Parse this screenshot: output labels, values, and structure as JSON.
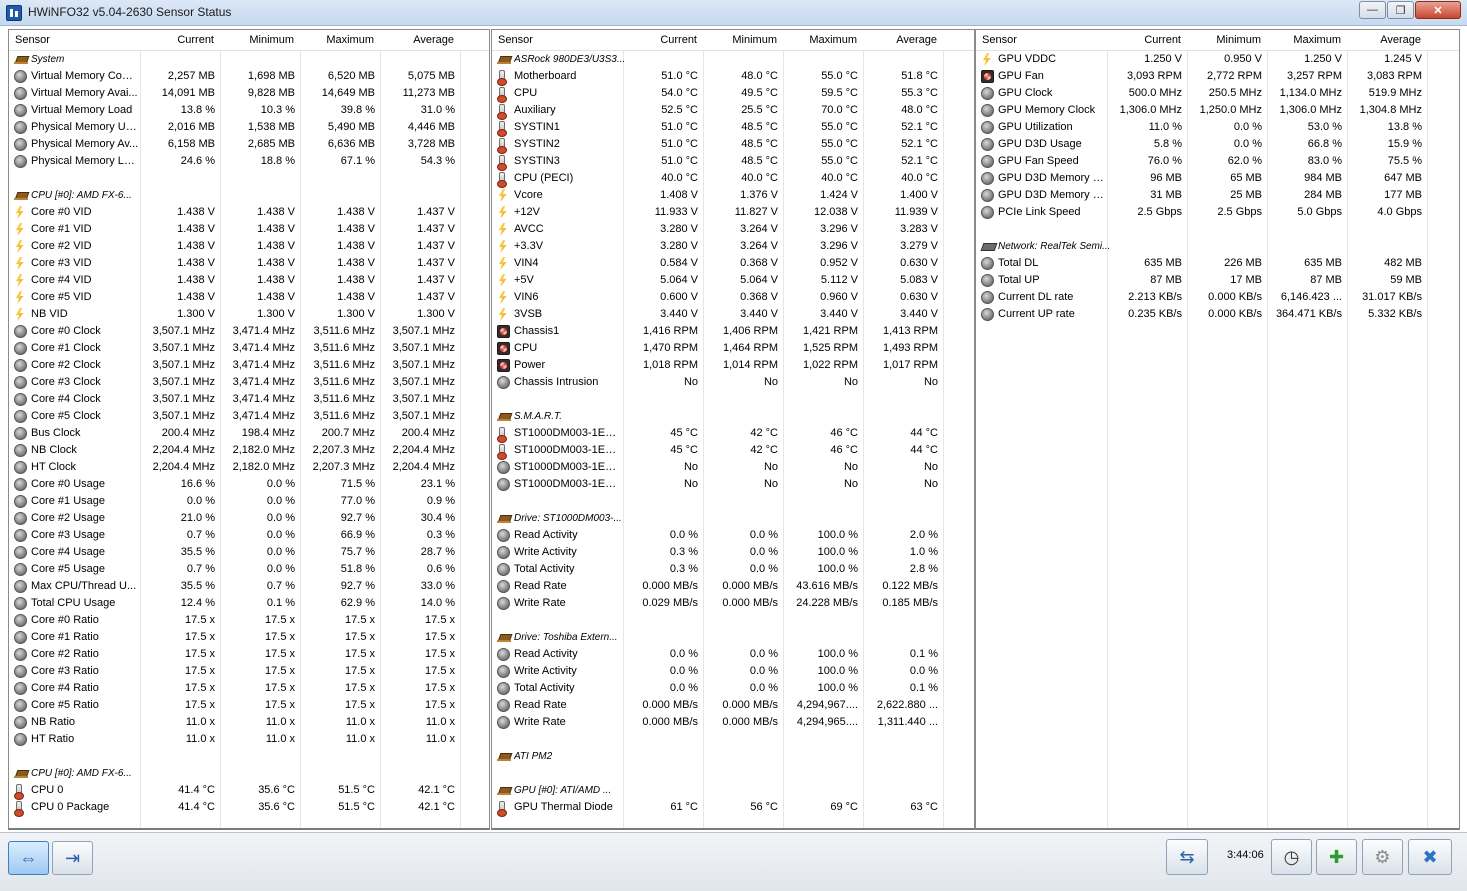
{
  "window": {
    "title": "HWiNFO32 v5.04-2630 Sensor Status",
    "minimize_glyph": "—",
    "restore_glyph": "❐",
    "close_glyph": "✕"
  },
  "columns": {
    "sensor": "Sensor",
    "current": "Current",
    "minimum": "Minimum",
    "maximum": "Maximum",
    "average": "Average"
  },
  "panels": [
    {
      "rows": [
        {
          "type": "group",
          "icon": "chip",
          "label": "System"
        },
        {
          "icon": "gauge",
          "label": "Virtual Memory Com...",
          "cur": "2,257 MB",
          "min": "1,698 MB",
          "max": "6,520 MB",
          "avg": "5,075 MB"
        },
        {
          "icon": "gauge",
          "label": "Virtual Memory Avai...",
          "cur": "14,091 MB",
          "min": "9,828 MB",
          "max": "14,649 MB",
          "avg": "11,273 MB"
        },
        {
          "icon": "gauge",
          "label": "Virtual Memory Load",
          "cur": "13.8 %",
          "min": "10.3 %",
          "max": "39.8 %",
          "avg": "31.0 %"
        },
        {
          "icon": "gauge",
          "label": "Physical Memory Used",
          "cur": "2,016 MB",
          "min": "1,538 MB",
          "max": "5,490 MB",
          "avg": "4,446 MB"
        },
        {
          "icon": "gauge",
          "label": "Physical Memory Av...",
          "cur": "6,158 MB",
          "min": "2,685 MB",
          "max": "6,636 MB",
          "avg": "3,728 MB"
        },
        {
          "icon": "gauge",
          "label": "Physical Memory Load",
          "cur": "24.6 %",
          "min": "18.8 %",
          "max": "67.1 %",
          "avg": "54.3 %"
        },
        {
          "type": "spacer"
        },
        {
          "type": "group",
          "icon": "chip",
          "label": "CPU [#0]: AMD FX-6..."
        },
        {
          "icon": "bolt",
          "label": "Core #0 VID",
          "cur": "1.438 V",
          "min": "1.438 V",
          "max": "1.438 V",
          "avg": "1.437 V"
        },
        {
          "icon": "bolt",
          "label": "Core #1 VID",
          "cur": "1.438 V",
          "min": "1.438 V",
          "max": "1.438 V",
          "avg": "1.437 V"
        },
        {
          "icon": "bolt",
          "label": "Core #2 VID",
          "cur": "1.438 V",
          "min": "1.438 V",
          "max": "1.438 V",
          "avg": "1.437 V"
        },
        {
          "icon": "bolt",
          "label": "Core #3 VID",
          "cur": "1.438 V",
          "min": "1.438 V",
          "max": "1.438 V",
          "avg": "1.437 V"
        },
        {
          "icon": "bolt",
          "label": "Core #4 VID",
          "cur": "1.438 V",
          "min": "1.438 V",
          "max": "1.438 V",
          "avg": "1.437 V"
        },
        {
          "icon": "bolt",
          "label": "Core #5 VID",
          "cur": "1.438 V",
          "min": "1.438 V",
          "max": "1.438 V",
          "avg": "1.437 V"
        },
        {
          "icon": "bolt",
          "label": "NB VID",
          "cur": "1.300 V",
          "min": "1.300 V",
          "max": "1.300 V",
          "avg": "1.300 V"
        },
        {
          "icon": "gauge",
          "label": "Core #0 Clock",
          "cur": "3,507.1 MHz",
          "min": "3,471.4 MHz",
          "max": "3,511.6 MHz",
          "avg": "3,507.1 MHz"
        },
        {
          "icon": "gauge",
          "label": "Core #1 Clock",
          "cur": "3,507.1 MHz",
          "min": "3,471.4 MHz",
          "max": "3,511.6 MHz",
          "avg": "3,507.1 MHz"
        },
        {
          "icon": "gauge",
          "label": "Core #2 Clock",
          "cur": "3,507.1 MHz",
          "min": "3,471.4 MHz",
          "max": "3,511.6 MHz",
          "avg": "3,507.1 MHz"
        },
        {
          "icon": "gauge",
          "label": "Core #3 Clock",
          "cur": "3,507.1 MHz",
          "min": "3,471.4 MHz",
          "max": "3,511.6 MHz",
          "avg": "3,507.1 MHz"
        },
        {
          "icon": "gauge",
          "label": "Core #4 Clock",
          "cur": "3,507.1 MHz",
          "min": "3,471.4 MHz",
          "max": "3,511.6 MHz",
          "avg": "3,507.1 MHz"
        },
        {
          "icon": "gauge",
          "label": "Core #5 Clock",
          "cur": "3,507.1 MHz",
          "min": "3,471.4 MHz",
          "max": "3,511.6 MHz",
          "avg": "3,507.1 MHz"
        },
        {
          "icon": "gauge",
          "label": "Bus Clock",
          "cur": "200.4 MHz",
          "min": "198.4 MHz",
          "max": "200.7 MHz",
          "avg": "200.4 MHz"
        },
        {
          "icon": "gauge",
          "label": "NB Clock",
          "cur": "2,204.4 MHz",
          "min": "2,182.0 MHz",
          "max": "2,207.3 MHz",
          "avg": "2,204.4 MHz"
        },
        {
          "icon": "gauge",
          "label": "HT Clock",
          "cur": "2,204.4 MHz",
          "min": "2,182.0 MHz",
          "max": "2,207.3 MHz",
          "avg": "2,204.4 MHz"
        },
        {
          "icon": "gauge",
          "label": "Core #0 Usage",
          "cur": "16.6 %",
          "min": "0.0 %",
          "max": "71.5 %",
          "avg": "23.1 %"
        },
        {
          "icon": "gauge",
          "label": "Core #1 Usage",
          "cur": "0.0 %",
          "min": "0.0 %",
          "max": "77.0 %",
          "avg": "0.9 %"
        },
        {
          "icon": "gauge",
          "label": "Core #2 Usage",
          "cur": "21.0 %",
          "min": "0.0 %",
          "max": "92.7 %",
          "avg": "30.4 %"
        },
        {
          "icon": "gauge",
          "label": "Core #3 Usage",
          "cur": "0.7 %",
          "min": "0.0 %",
          "max": "66.9 %",
          "avg": "0.3 %"
        },
        {
          "icon": "gauge",
          "label": "Core #4 Usage",
          "cur": "35.5 %",
          "min": "0.0 %",
          "max": "75.7 %",
          "avg": "28.7 %"
        },
        {
          "icon": "gauge",
          "label": "Core #5 Usage",
          "cur": "0.7 %",
          "min": "0.0 %",
          "max": "51.8 %",
          "avg": "0.6 %"
        },
        {
          "icon": "gauge",
          "label": "Max CPU/Thread U...",
          "cur": "35.5 %",
          "min": "0.7 %",
          "max": "92.7 %",
          "avg": "33.0 %"
        },
        {
          "icon": "gauge",
          "label": "Total CPU Usage",
          "cur": "12.4 %",
          "min": "0.1 %",
          "max": "62.9 %",
          "avg": "14.0 %"
        },
        {
          "icon": "gauge",
          "label": "Core #0 Ratio",
          "cur": "17.5 x",
          "min": "17.5 x",
          "max": "17.5 x",
          "avg": "17.5 x"
        },
        {
          "icon": "gauge",
          "label": "Core #1 Ratio",
          "cur": "17.5 x",
          "min": "17.5 x",
          "max": "17.5 x",
          "avg": "17.5 x"
        },
        {
          "icon": "gauge",
          "label": "Core #2 Ratio",
          "cur": "17.5 x",
          "min": "17.5 x",
          "max": "17.5 x",
          "avg": "17.5 x"
        },
        {
          "icon": "gauge",
          "label": "Core #3 Ratio",
          "cur": "17.5 x",
          "min": "17.5 x",
          "max": "17.5 x",
          "avg": "17.5 x"
        },
        {
          "icon": "gauge",
          "label": "Core #4 Ratio",
          "cur": "17.5 x",
          "min": "17.5 x",
          "max": "17.5 x",
          "avg": "17.5 x"
        },
        {
          "icon": "gauge",
          "label": "Core #5 Ratio",
          "cur": "17.5 x",
          "min": "17.5 x",
          "max": "17.5 x",
          "avg": "17.5 x"
        },
        {
          "icon": "gauge",
          "label": "NB Ratio",
          "cur": "11.0 x",
          "min": "11.0 x",
          "max": "11.0 x",
          "avg": "11.0 x"
        },
        {
          "icon": "gauge",
          "label": "HT Ratio",
          "cur": "11.0 x",
          "min": "11.0 x",
          "max": "11.0 x",
          "avg": "11.0 x"
        },
        {
          "type": "spacer"
        },
        {
          "type": "group",
          "icon": "chip",
          "label": "CPU [#0]: AMD FX-6..."
        },
        {
          "icon": "therm",
          "label": "CPU 0",
          "cur": "41.4 °C",
          "min": "35.6 °C",
          "max": "51.5 °C",
          "avg": "42.1 °C"
        },
        {
          "icon": "therm",
          "label": "CPU 0 Package",
          "cur": "41.4 °C",
          "min": "35.6 °C",
          "max": "51.5 °C",
          "avg": "42.1 °C"
        }
      ]
    },
    {
      "rows": [
        {
          "type": "group",
          "icon": "chip",
          "label": "ASRock 980DE3/U3S3..."
        },
        {
          "icon": "therm",
          "label": "Motherboard",
          "cur": "51.0 °C",
          "min": "48.0 °C",
          "max": "55.0 °C",
          "avg": "51.8 °C"
        },
        {
          "icon": "therm",
          "label": "CPU",
          "cur": "54.0 °C",
          "min": "49.5 °C",
          "max": "59.5 °C",
          "avg": "55.3 °C"
        },
        {
          "icon": "therm",
          "label": "Auxiliary",
          "cur": "52.5 °C",
          "min": "25.5 °C",
          "max": "70.0 °C",
          "avg": "48.0 °C"
        },
        {
          "icon": "therm",
          "label": "SYSTIN1",
          "cur": "51.0 °C",
          "min": "48.5 °C",
          "max": "55.0 °C",
          "avg": "52.1 °C"
        },
        {
          "icon": "therm",
          "label": "SYSTIN2",
          "cur": "51.0 °C",
          "min": "48.5 °C",
          "max": "55.0 °C",
          "avg": "52.1 °C"
        },
        {
          "icon": "therm",
          "label": "SYSTIN3",
          "cur": "51.0 °C",
          "min": "48.5 °C",
          "max": "55.0 °C",
          "avg": "52.1 °C"
        },
        {
          "icon": "therm",
          "label": "CPU (PECI)",
          "cur": "40.0 °C",
          "min": "40.0 °C",
          "max": "40.0 °C",
          "avg": "40.0 °C"
        },
        {
          "icon": "bolt",
          "label": "Vcore",
          "cur": "1.408 V",
          "min": "1.376 V",
          "max": "1.424 V",
          "avg": "1.400 V"
        },
        {
          "icon": "bolt",
          "label": "+12V",
          "cur": "11.933 V",
          "min": "11.827 V",
          "max": "12.038 V",
          "avg": "11.939 V"
        },
        {
          "icon": "bolt",
          "label": "AVCC",
          "cur": "3.280 V",
          "min": "3.264 V",
          "max": "3.296 V",
          "avg": "3.283 V"
        },
        {
          "icon": "bolt",
          "label": "+3.3V",
          "cur": "3.280 V",
          "min": "3.264 V",
          "max": "3.296 V",
          "avg": "3.279 V"
        },
        {
          "icon": "bolt",
          "label": "VIN4",
          "cur": "0.584 V",
          "min": "0.368 V",
          "max": "0.952 V",
          "avg": "0.630 V"
        },
        {
          "icon": "bolt",
          "label": "+5V",
          "cur": "5.064 V",
          "min": "5.064 V",
          "max": "5.112 V",
          "avg": "5.083 V"
        },
        {
          "icon": "bolt",
          "label": "VIN6",
          "cur": "0.600 V",
          "min": "0.368 V",
          "max": "0.960 V",
          "avg": "0.630 V"
        },
        {
          "icon": "bolt",
          "label": "3VSB",
          "cur": "3.440 V",
          "min": "3.440 V",
          "max": "3.440 V",
          "avg": "3.440 V"
        },
        {
          "icon": "fan",
          "label": "Chassis1",
          "cur": "1,416 RPM",
          "min": "1,406 RPM",
          "max": "1,421 RPM",
          "avg": "1,413 RPM"
        },
        {
          "icon": "fan",
          "label": "CPU",
          "cur": "1,470 RPM",
          "min": "1,464 RPM",
          "max": "1,525 RPM",
          "avg": "1,493 RPM"
        },
        {
          "icon": "fan",
          "label": "Power",
          "cur": "1,018 RPM",
          "min": "1,014 RPM",
          "max": "1,022 RPM",
          "avg": "1,017 RPM"
        },
        {
          "icon": "gauge",
          "label": "Chassis Intrusion",
          "cur": "No",
          "min": "No",
          "max": "No",
          "avg": "No"
        },
        {
          "type": "spacer"
        },
        {
          "type": "group",
          "icon": "chip",
          "label": "S.M.A.R.T."
        },
        {
          "icon": "therm",
          "label": "ST1000DM003-1ER1...",
          "cur": "45 °C",
          "min": "42 °C",
          "max": "46 °C",
          "avg": "44 °C"
        },
        {
          "icon": "therm",
          "label": "ST1000DM003-1ER1...",
          "cur": "45 °C",
          "min": "42 °C",
          "max": "46 °C",
          "avg": "44 °C"
        },
        {
          "icon": "gauge",
          "label": "ST1000DM003-1ER1...",
          "cur": "No",
          "min": "No",
          "max": "No",
          "avg": "No"
        },
        {
          "icon": "gauge",
          "label": "ST1000DM003-1ER1...",
          "cur": "No",
          "min": "No",
          "max": "No",
          "avg": "No"
        },
        {
          "type": "spacer"
        },
        {
          "type": "group",
          "icon": "chip",
          "label": "Drive: ST1000DM003-..."
        },
        {
          "icon": "gauge",
          "label": "Read Activity",
          "cur": "0.0 %",
          "min": "0.0 %",
          "max": "100.0 %",
          "avg": "2.0 %"
        },
        {
          "icon": "gauge",
          "label": "Write Activity",
          "cur": "0.3 %",
          "min": "0.0 %",
          "max": "100.0 %",
          "avg": "1.0 %"
        },
        {
          "icon": "gauge",
          "label": "Total Activity",
          "cur": "0.3 %",
          "min": "0.0 %",
          "max": "100.0 %",
          "avg": "2.8 %"
        },
        {
          "icon": "gauge",
          "label": "Read Rate",
          "cur": "0.000 MB/s",
          "min": "0.000 MB/s",
          "max": "43.616 MB/s",
          "avg": "0.122 MB/s"
        },
        {
          "icon": "gauge",
          "label": "Write Rate",
          "cur": "0.029 MB/s",
          "min": "0.000 MB/s",
          "max": "24.228 MB/s",
          "avg": "0.185 MB/s"
        },
        {
          "type": "spacer"
        },
        {
          "type": "group",
          "icon": "chip",
          "label": "Drive: Toshiba Extern..."
        },
        {
          "icon": "gauge",
          "label": "Read Activity",
          "cur": "0.0 %",
          "min": "0.0 %",
          "max": "100.0 %",
          "avg": "0.1 %"
        },
        {
          "icon": "gauge",
          "label": "Write Activity",
          "cur": "0.0 %",
          "min": "0.0 %",
          "max": "100.0 %",
          "avg": "0.0 %"
        },
        {
          "icon": "gauge",
          "label": "Total Activity",
          "cur": "0.0 %",
          "min": "0.0 %",
          "max": "100.0 %",
          "avg": "0.1 %"
        },
        {
          "icon": "gauge",
          "label": "Read Rate",
          "cur": "0.000 MB/s",
          "min": "0.000 MB/s",
          "max": "4,294,967....",
          "avg": "2,622.880 ..."
        },
        {
          "icon": "gauge",
          "label": "Write Rate",
          "cur": "0.000 MB/s",
          "min": "0.000 MB/s",
          "max": "4,294,965....",
          "avg": "1,311.440 ..."
        },
        {
          "type": "spacer"
        },
        {
          "type": "group",
          "icon": "chip",
          "label": "ATI PM2"
        },
        {
          "type": "spacer"
        },
        {
          "type": "group",
          "icon": "chip",
          "label": "GPU [#0]: ATI/AMD ..."
        },
        {
          "icon": "therm",
          "label": "GPU Thermal Diode",
          "cur": "61 °C",
          "min": "56 °C",
          "max": "69 °C",
          "avg": "63 °C"
        }
      ]
    },
    {
      "rows": [
        {
          "icon": "bolt",
          "label": "GPU VDDC",
          "cur": "1.250 V",
          "min": "0.950 V",
          "max": "1.250 V",
          "avg": "1.245 V"
        },
        {
          "icon": "fan",
          "label": "GPU Fan",
          "cur": "3,093 RPM",
          "min": "2,772 RPM",
          "max": "3,257 RPM",
          "avg": "3,083 RPM"
        },
        {
          "icon": "gauge",
          "label": "GPU Clock",
          "cur": "500.0 MHz",
          "min": "250.5 MHz",
          "max": "1,134.0 MHz",
          "avg": "519.9 MHz"
        },
        {
          "icon": "gauge",
          "label": "GPU Memory Clock",
          "cur": "1,306.0 MHz",
          "min": "1,250.0 MHz",
          "max": "1,306.0 MHz",
          "avg": "1,304.8 MHz"
        },
        {
          "icon": "gauge",
          "label": "GPU Utilization",
          "cur": "11.0 %",
          "min": "0.0 %",
          "max": "53.0 %",
          "avg": "13.8 %"
        },
        {
          "icon": "gauge",
          "label": "GPU D3D Usage",
          "cur": "5.8 %",
          "min": "0.0 %",
          "max": "66.8 %",
          "avg": "15.9 %"
        },
        {
          "icon": "gauge",
          "label": "GPU Fan Speed",
          "cur": "76.0 %",
          "min": "62.0 %",
          "max": "83.0 %",
          "avg": "75.5 %"
        },
        {
          "icon": "gauge",
          "label": "GPU D3D Memory De...",
          "cur": "96 MB",
          "min": "65 MB",
          "max": "984 MB",
          "avg": "647 MB"
        },
        {
          "icon": "gauge",
          "label": "GPU D3D Memory Dy...",
          "cur": "31 MB",
          "min": "25 MB",
          "max": "284 MB",
          "avg": "177 MB"
        },
        {
          "icon": "gauge",
          "label": "PCIe Link Speed",
          "cur": "2.5 Gbps",
          "min": "2.5 Gbps",
          "max": "5.0 Gbps",
          "avg": "4.0 Gbps"
        },
        {
          "type": "spacer"
        },
        {
          "type": "group",
          "icon": "net",
          "label": "Network: RealTek Semi..."
        },
        {
          "icon": "gauge",
          "label": "Total DL",
          "cur": "635 MB",
          "min": "226 MB",
          "max": "635 MB",
          "avg": "482 MB"
        },
        {
          "icon": "gauge",
          "label": "Total UP",
          "cur": "87 MB",
          "min": "17 MB",
          "max": "87 MB",
          "avg": "59 MB"
        },
        {
          "icon": "gauge",
          "label": "Current DL rate",
          "cur": "2.213 KB/s",
          "min": "0.000 KB/s",
          "max": "6,146.423 ...",
          "avg": "31.017 KB/s"
        },
        {
          "icon": "gauge",
          "label": "Current UP rate",
          "cur": "0.235 KB/s",
          "min": "0.000 KB/s",
          "max": "364.471 KB/s",
          "avg": "5.332 KB/s"
        }
      ]
    }
  ],
  "toolbar": {
    "expand_glyph": "⇔",
    "collapse_glyph": "⇥",
    "network_glyph": "⇆",
    "time": "3:44:06",
    "clock_glyph": "◷",
    "log_glyph": "✚",
    "settings_glyph": "⚙",
    "exit_glyph": "✖"
  }
}
